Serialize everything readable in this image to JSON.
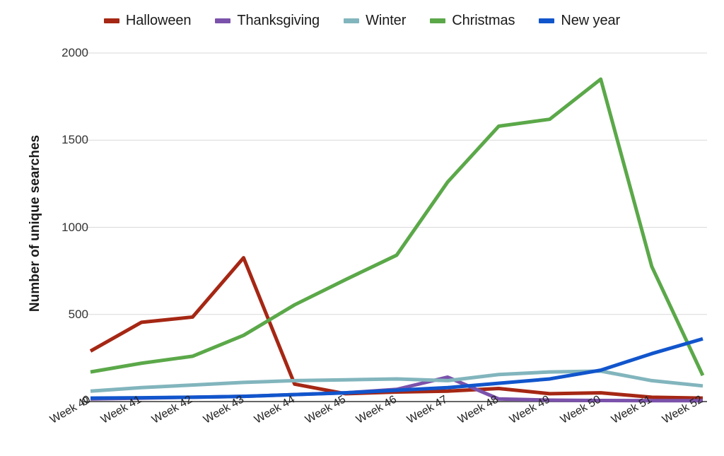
{
  "chart_data": {
    "type": "line",
    "title": "",
    "xlabel": "",
    "ylabel": "Number of unique searches",
    "categories": [
      "Week 40",
      "Week 41",
      "Week 42",
      "Week 43",
      "Week 44",
      "Week 45",
      "Week 46",
      "Week 47",
      "Week 48",
      "Week 49",
      "Week 50",
      "Week 51",
      "Week 52"
    ],
    "ylim": [
      0,
      2000
    ],
    "yticks": [
      0,
      500,
      1000,
      1500,
      2000
    ],
    "ytick_labels": [
      "0",
      "500",
      "1000",
      "1500",
      "2000"
    ],
    "grid": "horizontal",
    "legend_position": "top",
    "series": [
      {
        "name": "Halloween",
        "color": "#a52714",
        "values": [
          290,
          455,
          485,
          825,
          100,
          45,
          55,
          60,
          75,
          45,
          50,
          25,
          20
        ]
      },
      {
        "name": "Thanksgiving",
        "color": "#7b52ab",
        "values": [
          15,
          20,
          25,
          30,
          40,
          50,
          70,
          140,
          15,
          8,
          6,
          5,
          5
        ]
      },
      {
        "name": "Winter",
        "color": "#82b5bd",
        "values": [
          60,
          80,
          95,
          110,
          120,
          125,
          130,
          120,
          155,
          170,
          175,
          120,
          90
        ]
      },
      {
        "name": "Christmas",
        "color": "#5ba849",
        "values": [
          170,
          220,
          260,
          380,
          555,
          700,
          840,
          1260,
          1580,
          1620,
          1850,
          775,
          150
        ]
      },
      {
        "name": "New year",
        "color": "#1155cc",
        "values": [
          20,
          22,
          25,
          30,
          40,
          50,
          65,
          80,
          105,
          130,
          180,
          275,
          360
        ]
      }
    ]
  },
  "axis": {
    "y_title": "Number of unique searches"
  },
  "colors": {
    "gridline": "#d9d9d9",
    "axis": "#666666",
    "background": "#ffffff"
  }
}
